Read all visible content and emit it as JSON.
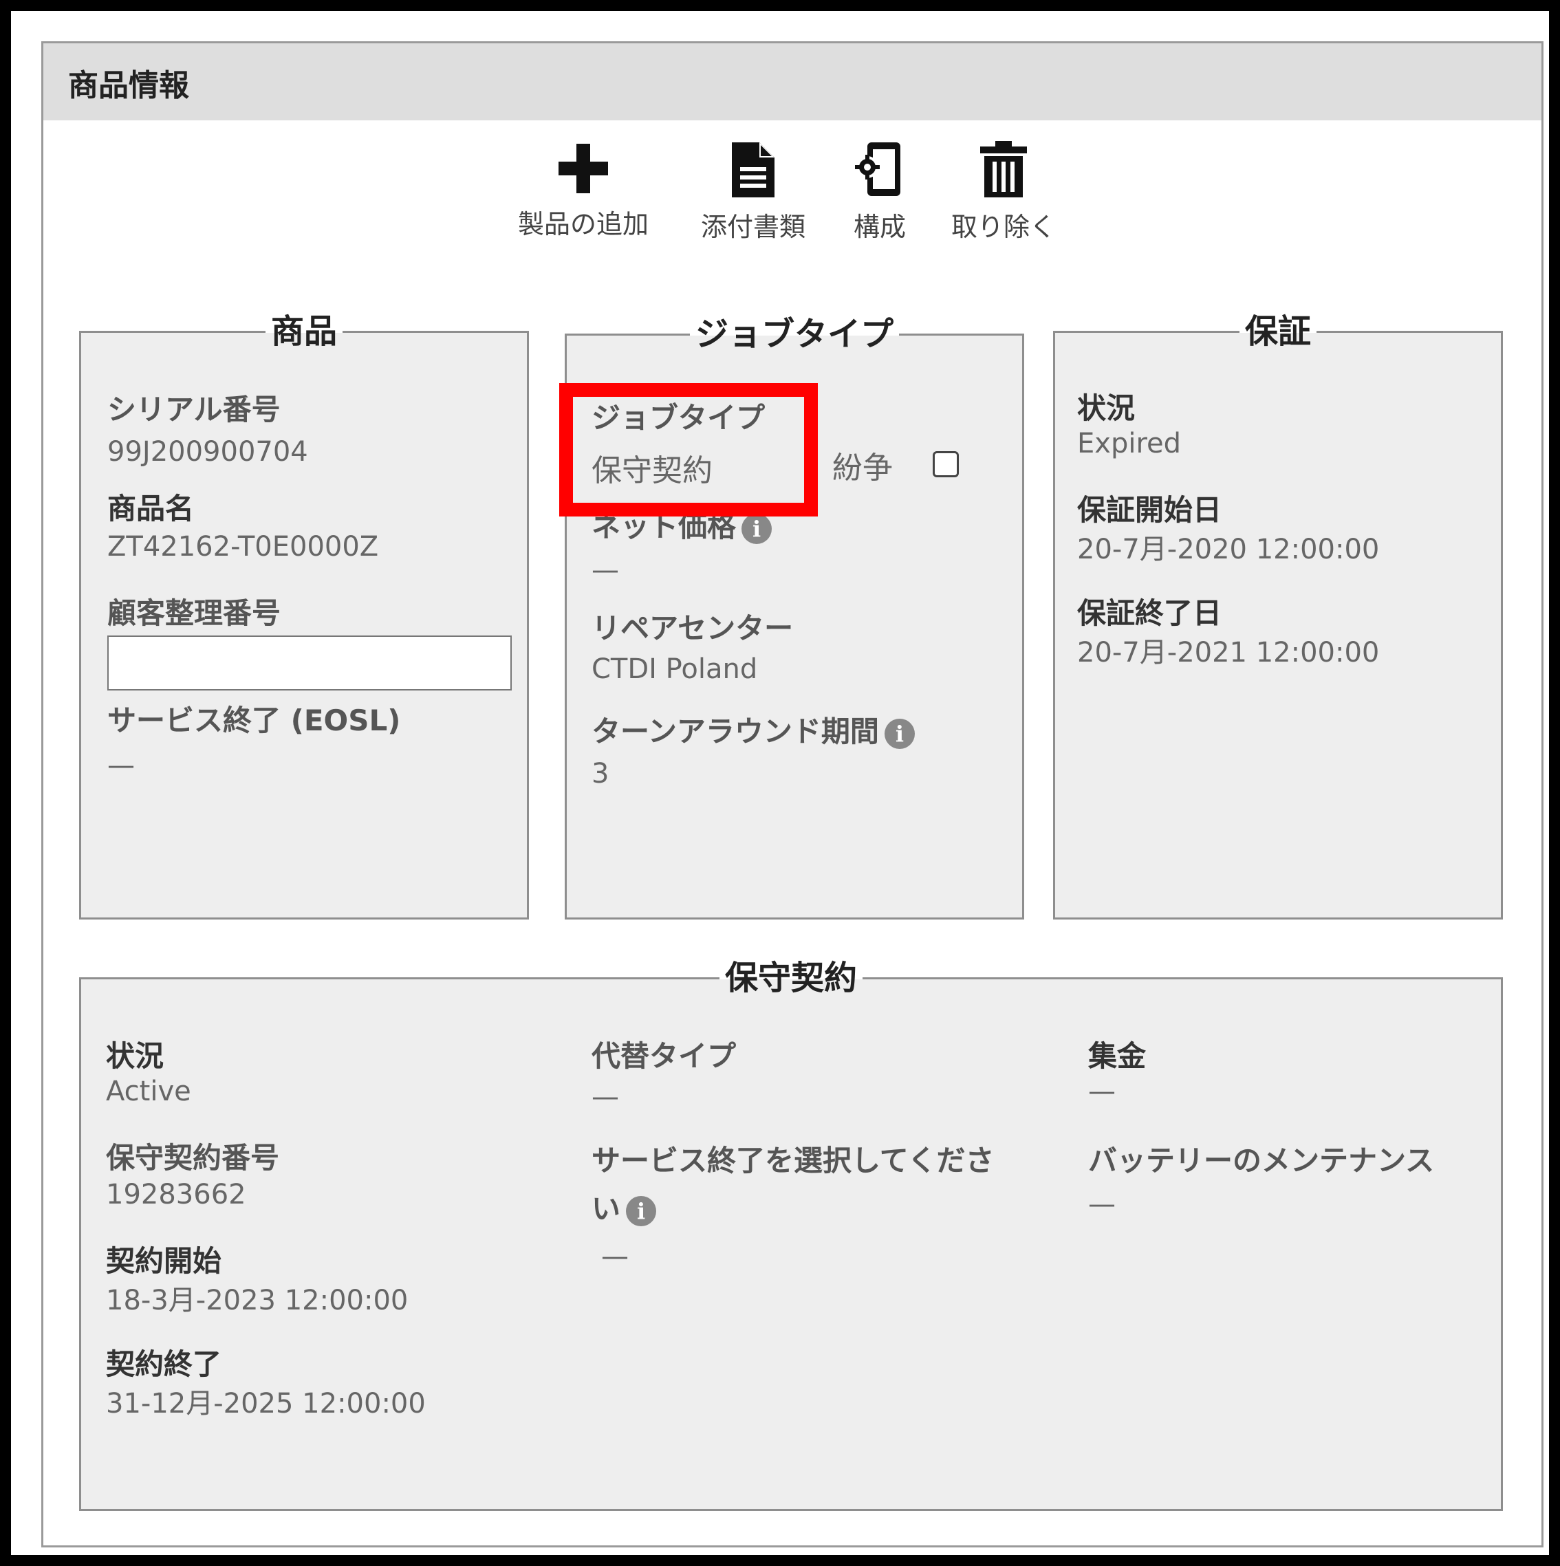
{
  "panel": {
    "title": "商品情報"
  },
  "toolbar": {
    "add_product": "製品の追加",
    "attachments": "添付書類",
    "configuration": "構成",
    "remove": "取り除く"
  },
  "product": {
    "legend": "商品",
    "serial_label": "シリアル番号",
    "serial_value": "99J200900704",
    "name_label": "商品名",
    "name_value": "ZT42162-T0E0000Z",
    "customer_ref_label": "顧客整理番号",
    "customer_ref_value": "",
    "eosl_label": "サービス終了 (EOSL)",
    "eosl_value": "—"
  },
  "jobtype": {
    "legend": "ジョブタイプ",
    "type_label": "ジョブタイプ",
    "type_value": "保守契約",
    "dispute_label": "紛争",
    "dispute_checked": false,
    "net_price_label": "ネット価格",
    "net_price_value": "—",
    "repair_center_label": "リペアセンター",
    "repair_center_value": "CTDI Poland",
    "turnaround_label": "ターンアラウンド期間",
    "turnaround_value": "3"
  },
  "warranty": {
    "legend": "保証",
    "status_label": "状況",
    "status_value": "Expired",
    "start_label": "保証開始日",
    "start_value": "20-7月-2020 12:00:00",
    "end_label": "保証終了日",
    "end_value": "20-7月-2021 12:00:00"
  },
  "contract": {
    "legend": "保守契約",
    "status_label": "状況",
    "status_value": "Active",
    "number_label": "保守契約番号",
    "number_value": "19283662",
    "start_label": "契約開始",
    "start_value": "18-3月-2023 12:00:00",
    "end_label": "契約終了",
    "end_value": "31-12月-2025 12:00:00",
    "replacement_label": "代替タイプ",
    "replacement_value": "—",
    "service_end_label_line1": "サービス終了を選択してくださ",
    "service_end_label_line2": "い",
    "service_end_value": "—",
    "collection_label": "集金",
    "collection_value": "—",
    "battery_label": "バッテリーのメンテナンス",
    "battery_value": "—"
  },
  "colors": {
    "highlight": "#ff0000",
    "group_bg": "#eeeeee",
    "header_bg": "#dedede"
  }
}
